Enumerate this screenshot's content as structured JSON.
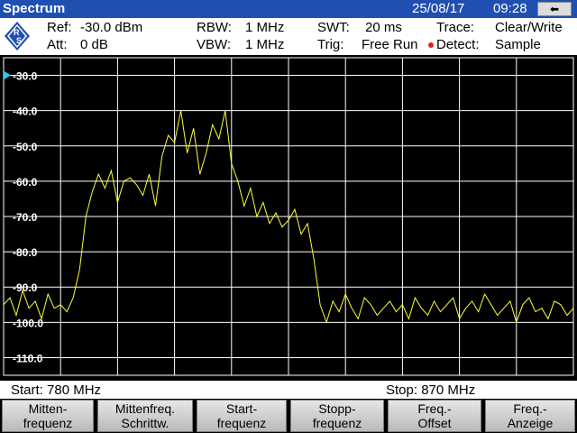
{
  "header": {
    "title": "Spectrum",
    "date": "25/08/17",
    "time": "09:28",
    "back_icon": "back-arrow-icon"
  },
  "settings": {
    "ref_label": "Ref:",
    "ref_value": "-30.0 dBm",
    "att_label": "Att:",
    "att_value": "0 dB",
    "rbw_label": "RBW:",
    "rbw_value": "1 MHz",
    "vbw_label": "VBW:",
    "vbw_value": "1 MHz",
    "swt_label": "SWT:",
    "swt_value": "20 ms",
    "trig_label": "Trig:",
    "trig_value": "Free Run",
    "trace_label": "Trace:",
    "trace_value": "Clear/Write",
    "detect_label": "Detect:",
    "detect_value": "Sample",
    "logo_text": "R S"
  },
  "colors": {
    "trace": "#ffff33",
    "grid": "#ffffff",
    "title_bar": "#1f4fb0",
    "ref_marker": "#2ec9e6"
  },
  "footer": {
    "start": "Start:  780 MHz",
    "stop": "Stop: 870 MHz"
  },
  "softkeys": [
    {
      "line1": "Mitten-",
      "line2": "frequenz"
    },
    {
      "line1": "Mittenfreq.",
      "line2": "Schrittw."
    },
    {
      "line1": "Start-",
      "line2": "frequenz"
    },
    {
      "line1": "Stopp-",
      "line2": "frequenz"
    },
    {
      "line1": "Freq.-",
      "line2": "Offset"
    },
    {
      "line1": "Freq.-",
      "line2": "Anzeige"
    }
  ],
  "chart_data": {
    "type": "line",
    "title": "",
    "xlabel": "",
    "ylabel": "",
    "xlim": [
      780,
      870
    ],
    "ylim": [
      -115,
      -25
    ],
    "grid": true,
    "y_ticks": [
      "-30.0",
      "-40.0",
      "-50.0",
      "-60.0",
      "-70.0",
      "-80.0",
      "-90.0",
      "-100.0",
      "-110.0"
    ],
    "y_tick_values": [
      -30,
      -40,
      -50,
      -60,
      -70,
      -80,
      -90,
      -100,
      -110
    ],
    "reference_level": -30,
    "series": [
      {
        "x": [
          780,
          781,
          782,
          783,
          784,
          785,
          786,
          787,
          788,
          789,
          790,
          791,
          792,
          793,
          794,
          795,
          796,
          797,
          798,
          799,
          800,
          801,
          802,
          803,
          804,
          805,
          806,
          807,
          808,
          809,
          810,
          811,
          812,
          813,
          814,
          815,
          816,
          817,
          818,
          819,
          820,
          821,
          822,
          823,
          824,
          825,
          826,
          827,
          828,
          829,
          830,
          831,
          832,
          833,
          834,
          835,
          836,
          837,
          838,
          839,
          840,
          841,
          842,
          843,
          844,
          845,
          846,
          847,
          848,
          849,
          850,
          851,
          852,
          853,
          854,
          855,
          856,
          857,
          858,
          859,
          860,
          861,
          862,
          863,
          864,
          865,
          866,
          867,
          868,
          869,
          870
        ],
        "values": [
          -95,
          -93,
          -98,
          -91,
          -96,
          -94,
          -99,
          -92,
          -96,
          -95,
          -97,
          -93,
          -85,
          -70,
          -63,
          -58,
          -62,
          -57,
          -66,
          -60,
          -59,
          -61,
          -64,
          -58,
          -67,
          -53,
          -47,
          -49,
          -40,
          -52,
          -45,
          -58,
          -52,
          -44,
          -48,
          -40,
          -55,
          -60,
          -67,
          -62,
          -70,
          -66,
          -72,
          -69,
          -73,
          -71,
          -68,
          -75,
          -72,
          -82,
          -95,
          -100,
          -94,
          -97,
          -92,
          -96,
          -99,
          -93,
          -95,
          -98,
          -96,
          -94,
          -97,
          -95,
          -99,
          -93,
          -96,
          -98,
          -94,
          -97,
          -95,
          -93,
          -99,
          -96,
          -94,
          -97,
          -92,
          -95,
          -98,
          -96,
          -94,
          -100,
          -95,
          -93,
          -97,
          -96,
          -99,
          -94,
          -95,
          -98,
          -96
        ]
      }
    ]
  }
}
